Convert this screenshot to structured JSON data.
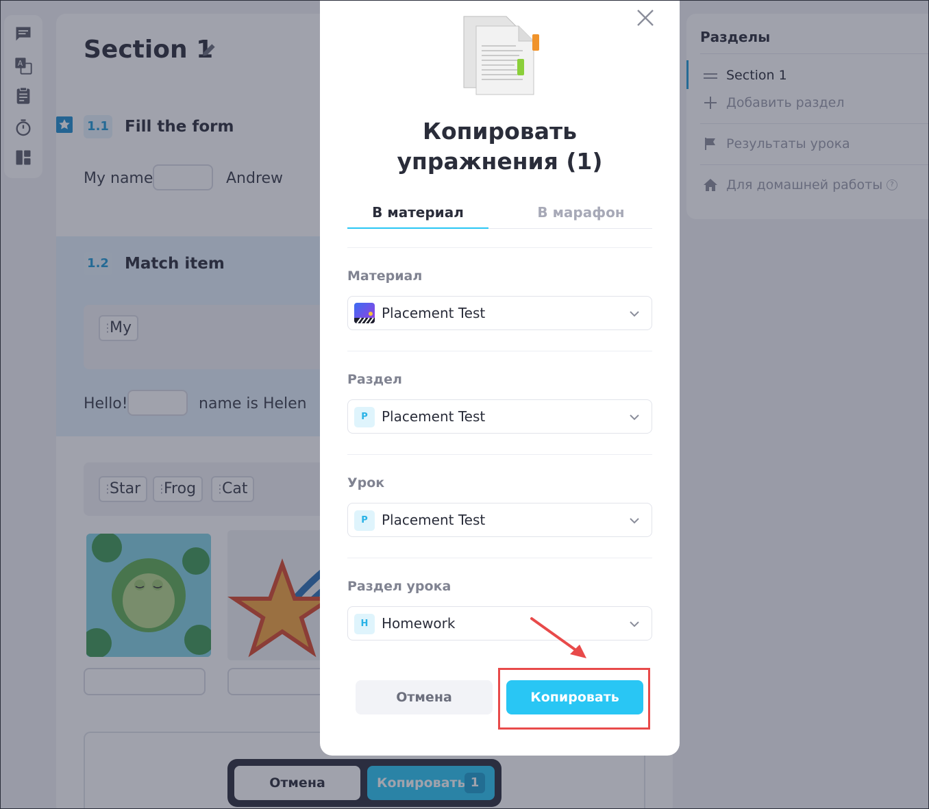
{
  "background": {
    "section_title": "Section 1",
    "exercises": [
      {
        "number": "1.1",
        "title": "Fill the form",
        "text_before": "My name",
        "text_after": "Andrew"
      },
      {
        "number": "1.2",
        "title": "Match item",
        "word_bank": [
          "My"
        ],
        "text_before": "Hello!",
        "text_after": "name is Helen"
      }
    ],
    "word_chips": [
      "Star",
      "Frog",
      "Cat"
    ]
  },
  "sections_panel": {
    "title": "Разделы",
    "items": [
      {
        "label": "Section 1",
        "icon": "drag-handle-icon"
      },
      {
        "label": "Добавить раздел",
        "icon": "plus-icon"
      },
      {
        "label": "Результаты урока",
        "icon": "flag-icon"
      },
      {
        "label": "Для домашней работы",
        "icon": "home-icon",
        "help": "?"
      }
    ]
  },
  "floating_bar": {
    "cancel_label": "Отмена",
    "copy_label": "Копировать",
    "count": "1"
  },
  "modal": {
    "title": "Копировать упражнения (1)",
    "tabs": [
      {
        "label": "В материал",
        "active": true
      },
      {
        "label": "В марафон",
        "active": false
      }
    ],
    "fields": [
      {
        "label": "Материал",
        "value": "Placement Test",
        "icon": "material-thumbnail"
      },
      {
        "label": "Раздел",
        "value": "Placement Test",
        "icon_letter": "P"
      },
      {
        "label": "Урок",
        "value": "Placement Test",
        "icon_letter": "P"
      },
      {
        "label": "Раздел урока",
        "value": "Homework",
        "icon_letter": "H"
      }
    ],
    "cancel_label": "Отмена",
    "copy_label": "Копировать"
  },
  "colors": {
    "accent": "#29c6f4",
    "badge_text": "#1e9ad6",
    "annotation_red": "#e84a4a",
    "overlay": "rgba(44,48,70,0.45)"
  }
}
